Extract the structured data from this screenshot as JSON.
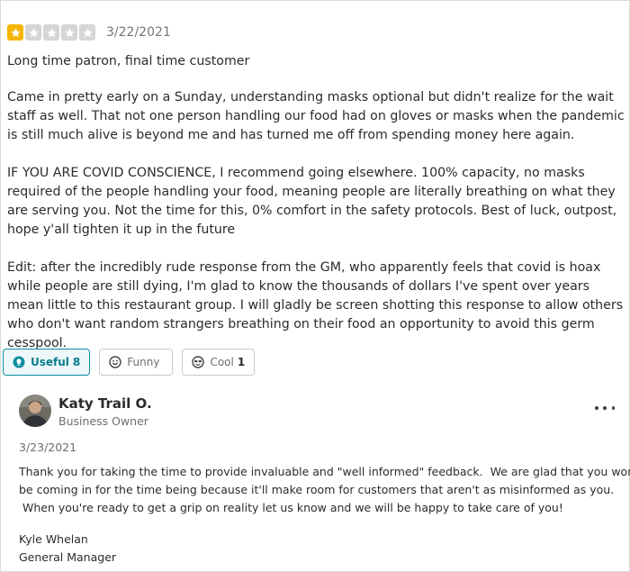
{
  "review": {
    "rating": 1,
    "rating_max": 5,
    "colors": {
      "star_filled": "#f5b400",
      "star_empty": "#d6d6d6"
    },
    "date": "3/22/2021",
    "title": "Long time patron, final time customer",
    "paragraphs": [
      "Came in pretty early on a Sunday, understanding masks optional but didn't realize for the wait staff as well. That not one person handling our food had on gloves or masks when the pandemic is still much alive is beyond me and has turned me off from spending money here again.",
      "IF YOU ARE COVID CONSCIENCE, I recommend going elsewhere. 100% capacity, no masks required of the people handling your food, meaning people are literally breathing on what they are serving you. Not the time for this, 0% comfort in the safety protocols. Best of luck, outpost, hope y'all tighten it up in the future",
      "Edit: after the incredibly rude response from the GM, who apparently feels that covid is hoax while people are still dying, I'm glad to know the thousands of dollars I've spent over years mean little to this restaurant group. I will gladly be screen shotting this response to allow others who don't want random strangers breathing on their food an opportunity to avoid this germ cesspool."
    ]
  },
  "reactions": [
    {
      "label": "Useful",
      "count": "8",
      "icon": "lightbulb-icon",
      "active": true
    },
    {
      "label": "Funny",
      "count": "",
      "icon": "smile-face-icon",
      "active": false
    },
    {
      "label": "Cool",
      "count": "1",
      "icon": "sunglasses-face-icon",
      "active": false
    }
  ],
  "owner_reply": {
    "name": "Katy Trail O.",
    "role": "Business Owner",
    "date": "3/23/2021",
    "body_lines": [
      "Thank you for taking the time to provide invaluable and \"well informed\" feedback.  We are glad that you won't",
      "be coming in for the time being because it'll make room for customers that aren't as misinformed as you.",
      " When you're ready to get a grip on reality let us know and we will be happy to take care of you!"
    ],
    "signature_name": "Kyle Whelan",
    "signature_title": "General Manager",
    "more_icon": "more-options-icon"
  }
}
